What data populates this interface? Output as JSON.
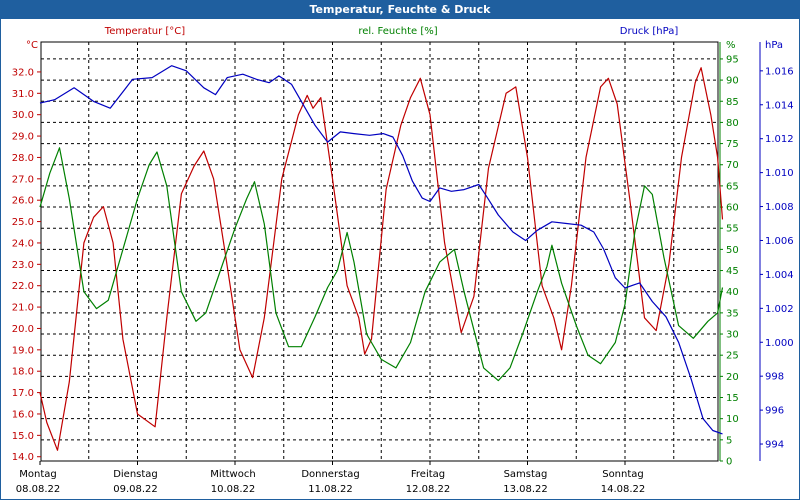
{
  "window": {
    "title": "Temperatur, Feuchte & Druck"
  },
  "colors": {
    "temperature": "#c00000",
    "humidity": "#008000",
    "pressure": "#0000c0",
    "title_bg": "#1f5f9f"
  },
  "chart_data": {
    "type": "line",
    "title": "Temperatur, Feuchte & Druck",
    "grid": true,
    "legend_placement": "top",
    "x": {
      "range": [
        0,
        7
      ],
      "ticks": [
        {
          "pos": 0,
          "day": "Montag",
          "date": "08.08.22"
        },
        {
          "pos": 1,
          "day": "Dienstag",
          "date": "09.08.22"
        },
        {
          "pos": 2,
          "day": "Mittwoch",
          "date": "10.08.22"
        },
        {
          "pos": 3,
          "day": "Donnerstag",
          "date": "11.08.22"
        },
        {
          "pos": 4,
          "day": "Freitag",
          "date": "12.08.22"
        },
        {
          "pos": 5,
          "day": "Samstag",
          "date": "13.08.22"
        },
        {
          "pos": 6,
          "day": "Sonntag",
          "date": "14.08.22"
        }
      ]
    },
    "axes": {
      "temperature": {
        "unit": "°C",
        "range": [
          13.8,
          33.4
        ],
        "ticks": [
          "14.0",
          "15.0",
          "16.0",
          "17.0",
          "18.0",
          "19.0",
          "20.0",
          "21.0",
          "22.0",
          "23.0",
          "24.0",
          "25.0",
          "26.0",
          "27.0",
          "28.0",
          "29.0",
          "30.0",
          "31.0",
          "32.0"
        ]
      },
      "humidity": {
        "unit": "%",
        "range": [
          0,
          99
        ],
        "ticks": [
          "0",
          "5",
          "10",
          "15",
          "20",
          "25",
          "30",
          "35",
          "40",
          "45",
          "50",
          "55",
          "60",
          "65",
          "70",
          "75",
          "80",
          "85",
          "90",
          "95"
        ]
      },
      "pressure": {
        "unit": "hPa",
        "range": [
          993.0,
          1017.7
        ],
        "ticks": [
          "994",
          "996",
          "998",
          "1.000",
          "1.002",
          "1.004",
          "1.006",
          "1.008",
          "1.010",
          "1.012",
          "1.014",
          "1.016"
        ]
      }
    },
    "series": [
      {
        "name": "Temperatur [°C]",
        "axis": "temperature",
        "color": "#c00000",
        "points": [
          [
            0,
            17.0
          ],
          [
            0.07,
            15.6
          ],
          [
            0.18,
            14.3
          ],
          [
            0.3,
            17.5
          ],
          [
            0.45,
            24.0
          ],
          [
            0.55,
            25.2
          ],
          [
            0.65,
            25.7
          ],
          [
            0.75,
            24.0
          ],
          [
            0.85,
            19.5
          ],
          [
            1.0,
            16.0
          ],
          [
            1.18,
            15.4
          ],
          [
            1.3,
            20.5
          ],
          [
            1.45,
            26.3
          ],
          [
            1.58,
            27.6
          ],
          [
            1.68,
            28.3
          ],
          [
            1.78,
            27.0
          ],
          [
            1.9,
            23.5
          ],
          [
            2.05,
            19.0
          ],
          [
            2.18,
            17.7
          ],
          [
            2.3,
            20.5
          ],
          [
            2.48,
            27.0
          ],
          [
            2.65,
            30.0
          ],
          [
            2.74,
            30.9
          ],
          [
            2.8,
            30.3
          ],
          [
            2.88,
            30.8
          ],
          [
            3.0,
            27.0
          ],
          [
            3.15,
            22.0
          ],
          [
            3.27,
            20.5
          ],
          [
            3.33,
            18.8
          ],
          [
            3.4,
            19.5
          ],
          [
            3.55,
            26.5
          ],
          [
            3.7,
            29.5
          ],
          [
            3.8,
            30.8
          ],
          [
            3.9,
            31.7
          ],
          [
            4.0,
            30.0
          ],
          [
            4.15,
            24.0
          ],
          [
            4.32,
            19.8
          ],
          [
            4.45,
            21.5
          ],
          [
            4.6,
            27.5
          ],
          [
            4.78,
            31.0
          ],
          [
            4.88,
            31.3
          ],
          [
            5.0,
            28.0
          ],
          [
            5.15,
            22.0
          ],
          [
            5.27,
            20.5
          ],
          [
            5.35,
            19.0
          ],
          [
            5.45,
            22.0
          ],
          [
            5.6,
            28.0
          ],
          [
            5.75,
            31.3
          ],
          [
            5.83,
            31.7
          ],
          [
            5.92,
            30.5
          ],
          [
            6.05,
            26.0
          ],
          [
            6.2,
            20.5
          ],
          [
            6.32,
            19.9
          ],
          [
            6.45,
            23.0
          ],
          [
            6.58,
            28.0
          ],
          [
            6.72,
            31.5
          ],
          [
            6.78,
            32.2
          ],
          [
            6.88,
            30.0
          ],
          [
            6.95,
            28.0
          ],
          [
            7.0,
            25.1
          ]
        ]
      },
      {
        "name": "rel. Feuchte [%]",
        "axis": "humidity",
        "color": "#008000",
        "points": [
          [
            0,
            60
          ],
          [
            0.1,
            68
          ],
          [
            0.2,
            74
          ],
          [
            0.3,
            62
          ],
          [
            0.45,
            40
          ],
          [
            0.58,
            36
          ],
          [
            0.7,
            38
          ],
          [
            0.85,
            50
          ],
          [
            1.0,
            62
          ],
          [
            1.12,
            70
          ],
          [
            1.2,
            73
          ],
          [
            1.3,
            65
          ],
          [
            1.45,
            40
          ],
          [
            1.6,
            33
          ],
          [
            1.7,
            35
          ],
          [
            1.85,
            45
          ],
          [
            2.0,
            55
          ],
          [
            2.12,
            62
          ],
          [
            2.2,
            66
          ],
          [
            2.3,
            56
          ],
          [
            2.42,
            35
          ],
          [
            2.55,
            27
          ],
          [
            2.68,
            27
          ],
          [
            2.82,
            34
          ],
          [
            2.95,
            41
          ],
          [
            3.05,
            45
          ],
          [
            3.15,
            54
          ],
          [
            3.22,
            47
          ],
          [
            3.35,
            30
          ],
          [
            3.5,
            24
          ],
          [
            3.65,
            22
          ],
          [
            3.8,
            28
          ],
          [
            3.95,
            40
          ],
          [
            4.1,
            47
          ],
          [
            4.25,
            50
          ],
          [
            4.35,
            40
          ],
          [
            4.55,
            22
          ],
          [
            4.7,
            19
          ],
          [
            4.82,
            22
          ],
          [
            4.95,
            30
          ],
          [
            5.1,
            40
          ],
          [
            5.2,
            46
          ],
          [
            5.25,
            51
          ],
          [
            5.35,
            42
          ],
          [
            5.5,
            32
          ],
          [
            5.62,
            25
          ],
          [
            5.75,
            23
          ],
          [
            5.9,
            28
          ],
          [
            6.0,
            37
          ],
          [
            6.1,
            54
          ],
          [
            6.2,
            65
          ],
          [
            6.28,
            63
          ],
          [
            6.4,
            48
          ],
          [
            6.55,
            32
          ],
          [
            6.7,
            29
          ],
          [
            6.85,
            33
          ],
          [
            6.95,
            35
          ],
          [
            7.0,
            41
          ]
        ]
      },
      {
        "name": "Druck [hPa]",
        "axis": "pressure",
        "color": "#0000c0",
        "points": [
          [
            0,
            1014.1
          ],
          [
            0.15,
            1014.3
          ],
          [
            0.35,
            1015.0
          ],
          [
            0.55,
            1014.2
          ],
          [
            0.72,
            1013.8
          ],
          [
            0.95,
            1015.5
          ],
          [
            1.15,
            1015.6
          ],
          [
            1.35,
            1016.3
          ],
          [
            1.5,
            1016.0
          ],
          [
            1.68,
            1015.0
          ],
          [
            1.8,
            1014.6
          ],
          [
            1.92,
            1015.6
          ],
          [
            2.08,
            1015.8
          ],
          [
            2.22,
            1015.5
          ],
          [
            2.35,
            1015.3
          ],
          [
            2.45,
            1015.7
          ],
          [
            2.58,
            1015.2
          ],
          [
            2.7,
            1014.0
          ],
          [
            2.82,
            1012.8
          ],
          [
            2.95,
            1011.8
          ],
          [
            3.08,
            1012.4
          ],
          [
            3.22,
            1012.3
          ],
          [
            3.38,
            1012.2
          ],
          [
            3.52,
            1012.3
          ],
          [
            3.62,
            1012.1
          ],
          [
            3.72,
            1011.0
          ],
          [
            3.82,
            1009.5
          ],
          [
            3.92,
            1008.5
          ],
          [
            4.0,
            1008.3
          ],
          [
            4.1,
            1009.1
          ],
          [
            4.22,
            1008.9
          ],
          [
            4.35,
            1009.0
          ],
          [
            4.5,
            1009.3
          ],
          [
            4.58,
            1008.6
          ],
          [
            4.7,
            1007.5
          ],
          [
            4.85,
            1006.5
          ],
          [
            4.98,
            1006.0
          ],
          [
            5.1,
            1006.6
          ],
          [
            5.25,
            1007.1
          ],
          [
            5.4,
            1007.0
          ],
          [
            5.55,
            1006.9
          ],
          [
            5.68,
            1006.5
          ],
          [
            5.78,
            1005.5
          ],
          [
            5.9,
            1003.8
          ],
          [
            6.0,
            1003.2
          ],
          [
            6.15,
            1003.5
          ],
          [
            6.28,
            1002.4
          ],
          [
            6.42,
            1001.5
          ],
          [
            6.55,
            1000.0
          ],
          [
            6.68,
            997.8
          ],
          [
            6.8,
            995.5
          ],
          [
            6.9,
            994.8
          ],
          [
            7.0,
            994.6
          ]
        ]
      }
    ]
  }
}
